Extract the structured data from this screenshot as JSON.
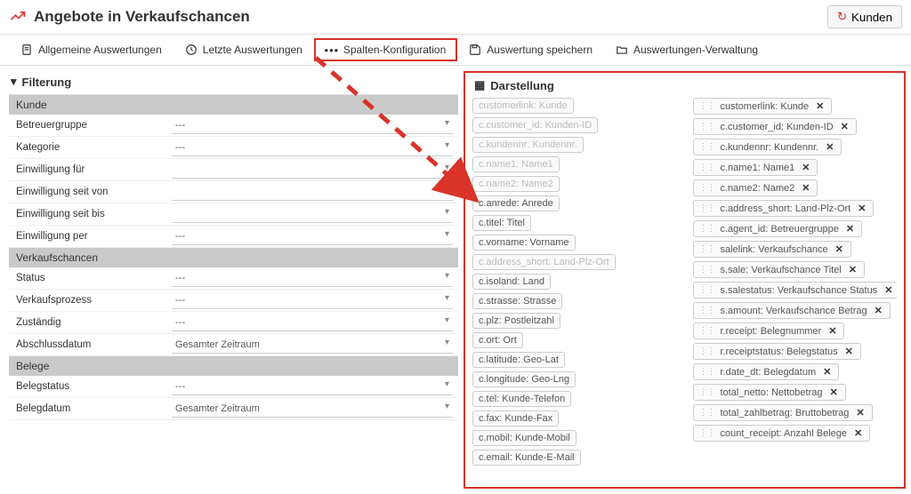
{
  "header": {
    "title": "Angebote in Verkaufschancen",
    "kunden_btn": "Kunden"
  },
  "toolbar": {
    "items": [
      {
        "label": "Allgemeine Auswertungen",
        "icon": "doc"
      },
      {
        "label": "Letzte Auswertungen",
        "icon": "clock"
      },
      {
        "label": "Spalten-Konfiguration",
        "icon": "dots",
        "highlight": true
      },
      {
        "label": "Auswertung speichern",
        "icon": "save"
      },
      {
        "label": "Auswertungen-Verwaltung",
        "icon": "folder"
      }
    ]
  },
  "filter": {
    "heading": "Filterung",
    "groups": [
      {
        "title": "Kunde",
        "rows": [
          {
            "label": "Betreuergruppe",
            "value": "---"
          },
          {
            "label": "Kategorie",
            "value": "---"
          },
          {
            "label": "Einwilligung für",
            "value": ""
          },
          {
            "label": "Einwilligung seit von",
            "value": ""
          },
          {
            "label": "Einwilligung seit bis",
            "value": ""
          },
          {
            "label": "Einwilligung per",
            "value": "---"
          }
        ]
      },
      {
        "title": "Verkaufschancen",
        "rows": [
          {
            "label": "Status",
            "value": "---"
          },
          {
            "label": "Verkaufsprozess",
            "value": "---"
          },
          {
            "label": "Zuständig",
            "value": "---"
          },
          {
            "label": "Abschlussdatum",
            "value": "Gesamter Zeitraum"
          }
        ]
      },
      {
        "title": "Belege",
        "rows": [
          {
            "label": "Belegstatus",
            "value": "---"
          },
          {
            "label": "Belegdatum",
            "value": "Gesamter Zeitraum"
          }
        ]
      }
    ]
  },
  "panel": {
    "heading": "Darstellung",
    "available": [
      {
        "label": "customerlink: Kunde",
        "disabled": true
      },
      {
        "label": "c.customer_id: Kunden-ID",
        "disabled": true
      },
      {
        "label": "c.kundennr: Kundennr.",
        "disabled": true
      },
      {
        "label": "c.name1: Name1",
        "disabled": true
      },
      {
        "label": "c.name2: Name2",
        "disabled": true
      },
      {
        "label": "c.anrede: Anrede"
      },
      {
        "label": "c.titel: Titel"
      },
      {
        "label": "c.vorname: Vorname"
      },
      {
        "label": "c.address_short: Land-Plz-Ort",
        "disabled": true
      },
      {
        "label": "c.isoland: Land"
      },
      {
        "label": "c.strasse: Strasse"
      },
      {
        "label": "c.plz: Postleitzahl"
      },
      {
        "label": "c.ort: Ort"
      },
      {
        "label": "c.latitude: Geo-Lat"
      },
      {
        "label": "c.longitude: Geo-Lng"
      },
      {
        "label": "c.tel: Kunde-Telefon"
      },
      {
        "label": "c.fax: Kunde-Fax"
      },
      {
        "label": "c.mobil: Kunde-Mobil"
      },
      {
        "label": "c.email: Kunde-E-Mail"
      }
    ],
    "selected": [
      {
        "label": "customerlink: Kunde"
      },
      {
        "label": "c.customer_id: Kunden-ID"
      },
      {
        "label": "c.kundennr: Kundennr."
      },
      {
        "label": "c.name1: Name1"
      },
      {
        "label": "c.name2: Name2"
      },
      {
        "label": "c.address_short: Land-Plz-Ort"
      },
      {
        "label": "c.agent_id: Betreuergruppe"
      },
      {
        "label": "salelink: Verkaufschance"
      },
      {
        "label": "s.sale: Verkaufschance Titel"
      },
      {
        "label": "s.salestatus: Verkaufschance Status"
      },
      {
        "label": "s.amount: Verkaufschance Betrag"
      },
      {
        "label": "r.receipt: Belegnummer"
      },
      {
        "label": "r.receiptstatus: Belegstatus"
      },
      {
        "label": "r.date_dt: Belegdatum"
      },
      {
        "label": "total_netto: Nettobetrag"
      },
      {
        "label": "total_zahlbetrag: Bruttobetrag"
      },
      {
        "label": "count_receipt: Anzahl Belege"
      }
    ]
  }
}
